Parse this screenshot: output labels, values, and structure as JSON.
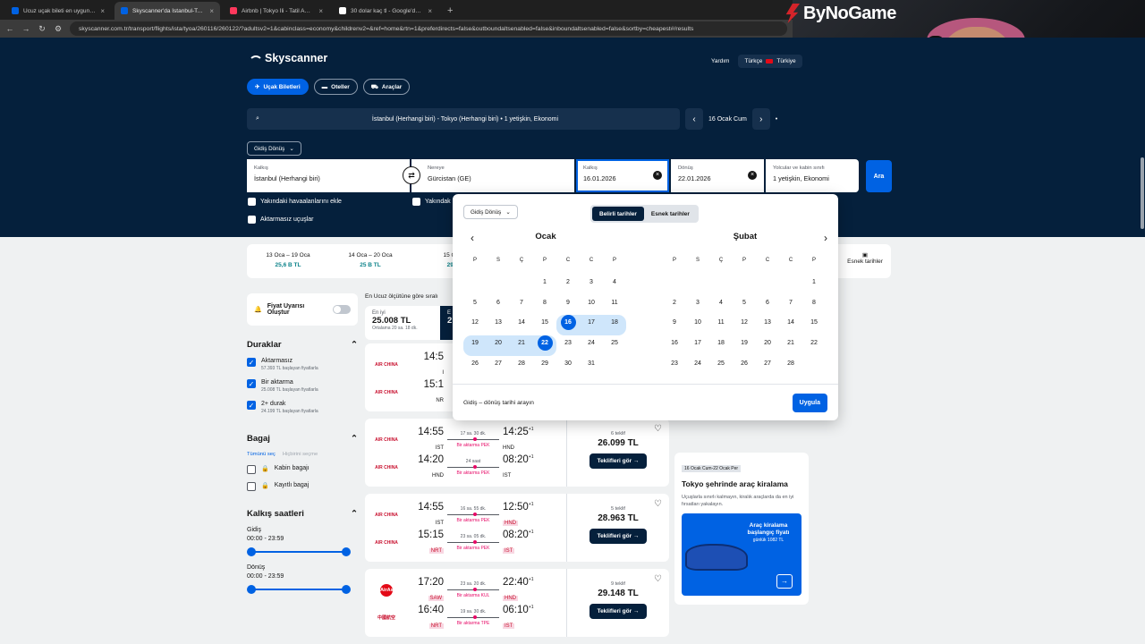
{
  "browser": {
    "tabs": [
      {
        "label": "Ucuz uçak bileti en uygun uçak",
        "color": "#0062e3",
        "active": false
      },
      {
        "label": "Skyscanner'da İstanbul-Tokyo a",
        "color": "#0062e3",
        "active": true
      },
      {
        "label": "Airbnb | Tokyo İli - Tatil Amaçlı",
        "color": "#ff385c",
        "active": false
      },
      {
        "label": "30 dolar kaç tl - Google'da Ara",
        "color": "#ffffff",
        "active": false
      }
    ],
    "new_tab": "+",
    "url": "skyscanner.com.tr/transport/flights/ista/tyoa/260116/260122/?adultsv2=1&cabinclass=economy&childrenv2=&ref=home&rtn=1&preferdirects=false&outboundaltsenabled=false&inboundaltsenabled=false&sortby=cheapest#/results"
  },
  "overlay": {
    "brand": "ByNoGame"
  },
  "header": {
    "logo": "Skyscanner",
    "help": "Yardım",
    "language": "Türkçe",
    "country": "Türkiye",
    "pills": [
      "Uçak Biletleri",
      "Oteller",
      "Araçlar"
    ],
    "summary": "İstanbul (Herhangi biri) - Tokyo (Herhangi biri) • 1 yetişkin, Ekonomi",
    "date_nav": "16 Ocak Cum"
  },
  "search": {
    "trip_type": "Gidiş Dönüş",
    "from_label": "Kalkış",
    "from_value": "İstanbul (Herhangi biri)",
    "to_label": "Nereye",
    "to_value": "Gürcistan (GE)",
    "depart_label": "Kalkış",
    "depart_value": "16.01.2026",
    "return_label": "Dönüş",
    "return_value": "22.01.2026",
    "pax_label": "Yolcular ve kabin sınıfı",
    "pax_value": "1 yetişkin, Ekonomi",
    "search_button": "Ara",
    "nearby_from": "Yakındaki havaalanlarını ekle",
    "nearby_to": "Yakındak",
    "direct_only": "Aktarmasız uçuşlar"
  },
  "date_strip": [
    {
      "range": "13 Oca – 19 Oca",
      "price": "25,6 B TL"
    },
    {
      "range": "14 Oca – 20 Oca",
      "price": "25 B TL"
    },
    {
      "range": "15 Oca",
      "price": "29,5"
    }
  ],
  "flexible_dates": "Esnek tarihler",
  "sidebar": {
    "alert": "Fiyat Uyarısı Oluştur",
    "stops_title": "Duraklar",
    "stops": [
      {
        "label": "Aktarmasız",
        "sub": "57.393 TL başlayan fiyatlarla"
      },
      {
        "label": "Bir aktarma",
        "sub": "25.008 TL başlayan fiyatlarla"
      },
      {
        "label": "2+ durak",
        "sub": "24.199 TL başlayan fiyatlarla"
      }
    ],
    "baggage_title": "Bagaj",
    "select_all": "Tümünü seç",
    "clear_all": "Hiçbirini seçme",
    "baggage": [
      "Kabin bagajı",
      "Kayıtlı bagaj"
    ],
    "times_title": "Kalkış saatleri",
    "outbound_label": "Gidiş",
    "outbound_range": "00:00 - 23:59",
    "return_label": "Dönüş",
    "return_range": "00:00 - 23:59"
  },
  "results": {
    "sort_text": "En Ucuz ölçütüne göre sıralı",
    "best_label": "En iyi",
    "best_price": "25.008 TL",
    "best_sub": "Ortalama 20 sa. 18 dk.",
    "dark_tab_label": "E",
    "dark_tab_price": "2",
    "cards": [
      {
        "partial": true,
        "airline_out": "AIR CHINA",
        "airline_in": "AIR CHINA",
        "out": {
          "dep": "14:5",
          "from": "I"
        },
        "in": {
          "dep": "15:1",
          "from": "NR"
        }
      },
      {
        "airline_out": "AIR CHINA",
        "airline_in": "AIR CHINA",
        "out": {
          "dep": "14:55",
          "from": "IST",
          "dur": "17 sa. 30 dk.",
          "stop": "Bir aktarma PEK",
          "arr": "14:25",
          "plus": "+1",
          "to": "HND"
        },
        "in": {
          "dep": "14:20",
          "from": "HND",
          "dur": "24 saat",
          "stop": "Bir aktarma PEK",
          "arr": "08:20",
          "plus": "+1",
          "to": "IST"
        },
        "deals": "6 teklif",
        "price": "26.099 TL",
        "button": "Teklifleri gör →"
      },
      {
        "airline_out": "AIR CHINA",
        "airline_in": "AIR CHINA",
        "out": {
          "dep": "14:55",
          "from": "IST",
          "dur": "16 sa. 55 dk.",
          "stop": "Bir aktarma PEK",
          "arr": "12:50",
          "plus": "+1",
          "to": "HND"
        },
        "in": {
          "dep": "15:15",
          "from": "NRT",
          "dur": "23 sa. 05 dk.",
          "stop": "Bir aktarma PEK",
          "arr": "08:20",
          "plus": "+1",
          "to": "IST"
        },
        "deals": "5 teklif",
        "price": "28.963 TL",
        "button": "Teklifleri gör →"
      },
      {
        "airline_out": "AirAsia",
        "airline_in": "中國航空",
        "out": {
          "dep": "17:20",
          "from": "SAW",
          "dur": "23 sa. 20 dk.",
          "stop": "Bir aktarma KUL",
          "arr": "22:40",
          "plus": "+1",
          "to": "HND"
        },
        "in": {
          "dep": "16:40",
          "from": "NRT",
          "dur": "19 sa. 30 dk.",
          "stop": "Bir aktarma TPE",
          "arr": "06:10",
          "plus": "+1",
          "to": "IST"
        },
        "deals": "9 teklif",
        "price": "29.148 TL",
        "button": "Teklifleri gör →"
      }
    ]
  },
  "ad": {
    "tag": "16 Ocak Cum-22 Ocak Per",
    "title": "Tokyo şehrinde araç kiralama",
    "desc": "Uçuşlarla sınırlı kalmayın, kiralık araçlarda da en iyi fırsatları yakalayın.",
    "banner_title": "Araç kiralama başlangıç fiyatı",
    "banner_price": "günlük 1082 TL"
  },
  "calendar": {
    "trip_type": "Gidiş Dönüş",
    "modes": [
      "Belirli tarihler",
      "Esnek tarihler"
    ],
    "weekdays": [
      "P",
      "S",
      "Ç",
      "P",
      "C",
      "C",
      "P"
    ],
    "months": [
      {
        "name": "Ocak",
        "start": 3,
        "days": 31
      },
      {
        "name": "Şubat",
        "start": 6,
        "days": 28
      }
    ],
    "selected_start": 16,
    "selected_end": 22,
    "footer": "Gidiş – dönüş tarihi arayın",
    "apply": "Uygula",
    "colors": {
      "accent": "#0062e3",
      "range": "#cfe6fb"
    }
  }
}
